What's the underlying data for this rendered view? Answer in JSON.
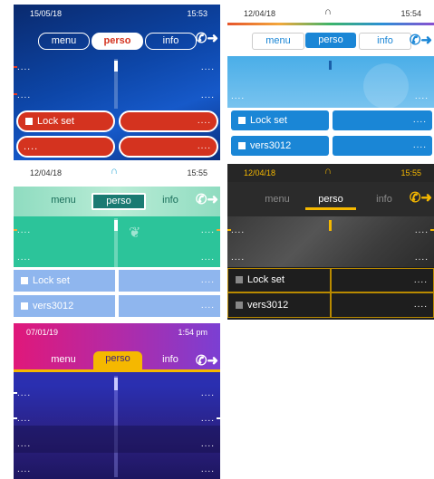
{
  "screens": [
    {
      "date": "15/05/18",
      "time": "15:53",
      "tabs": [
        "menu",
        "perso",
        "info"
      ],
      "line_dots": [
        "....",
        "....",
        "....",
        "...."
      ],
      "keys": [
        "Lock set",
        "....",
        "....",
        "....",
        "....",
        "...."
      ]
    },
    {
      "date": "12/04/18",
      "time": "15:54",
      "tabs": [
        "menu",
        "perso",
        "info"
      ],
      "line_dots": [
        "....",
        "...."
      ],
      "keys": [
        "Lock set",
        "....",
        "vers3012",
        "...."
      ]
    },
    {
      "date": "12/04/18",
      "time": "15:55",
      "tabs": [
        "menu",
        "perso",
        "info"
      ],
      "line_dots": [
        "....",
        "....",
        "....",
        "...."
      ],
      "keys": [
        "Lock set",
        "....",
        "vers3012",
        "...."
      ]
    },
    {
      "date": "12/04/18",
      "time": "15:55",
      "tabs": [
        "menu",
        "perso",
        "info"
      ],
      "line_dots": [
        "....",
        "....",
        "....",
        "...."
      ],
      "keys": [
        "Lock set",
        "....",
        "vers3012",
        "...."
      ]
    },
    {
      "date": "07/01/19",
      "time": "1:54 pm",
      "tabs": [
        "menu",
        "perso",
        "info"
      ],
      "line_dots": [
        "....",
        "....",
        "....",
        "....",
        "....",
        "....",
        "....",
        "...."
      ]
    }
  ],
  "icons": {
    "call_forward": "call-forward-icon",
    "handset": "handset-icon",
    "leaf": "leaf-icon"
  },
  "colors": {
    "theme_red": "#d4331f",
    "theme_blue": "#1a86d6",
    "theme_green": "#2cc49a",
    "theme_dark": "#2e2e2e",
    "theme_purple": "#6a3bc9",
    "accent_yellow": "#f5b800"
  }
}
